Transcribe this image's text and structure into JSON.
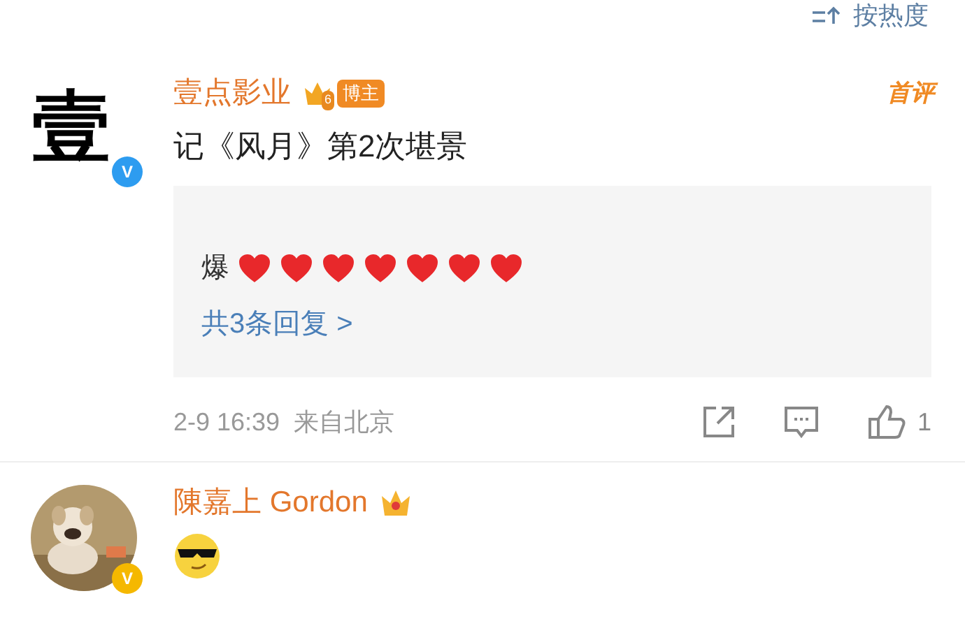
{
  "sort": {
    "label": "按热度"
  },
  "comments": [
    {
      "kind": "logo_avatar",
      "avatar_text": "壹",
      "verified": "V",
      "color": "#2d9cf0",
      "name": "壹点影业",
      "badge": "博主",
      "level_mark": "6",
      "tag": "首评",
      "text": "记《风月》第2次堪景",
      "reply": {
        "text": "爆",
        "parts": [
          {
            "kind": "heart"
          },
          {
            "kind": "heart"
          },
          {
            "kind": "heart"
          },
          {
            "kind": "heart"
          },
          {
            "kind": "heart"
          },
          {
            "kind": "heart"
          },
          {
            "kind": "heart"
          }
        ],
        "more": "共3条回复 >"
      },
      "time": "2-9 16:39",
      "source": "来自北京",
      "likes": "1"
    },
    {
      "kind": "photo_avatar",
      "verified": "V",
      "color": "#f5b800",
      "name": "陳嘉上 Gordon"
    }
  ]
}
